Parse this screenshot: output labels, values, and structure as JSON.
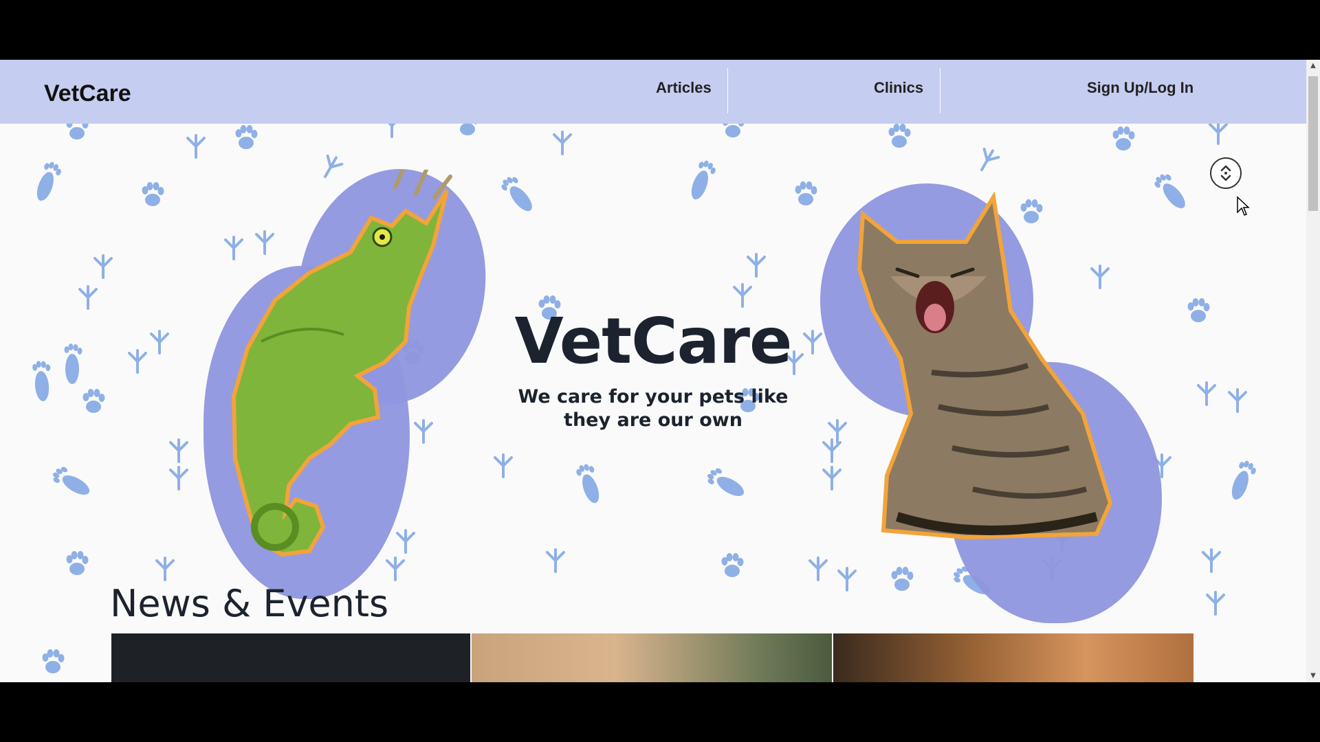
{
  "navbar": {
    "brand": "VetCare",
    "links": [
      "Articles",
      "Clinics",
      "Sign Up/Log In"
    ]
  },
  "hero": {
    "title": "VetCare",
    "subtitle": "We care for your pets like they are our own",
    "images": [
      "chameleon-image",
      "cat-image"
    ]
  },
  "news": {
    "title": "News & Events",
    "cards": [
      "news-card-1",
      "news-card-2",
      "news-card-3"
    ]
  },
  "icons": {
    "scroll": "chevron-up-down-icon",
    "cursor": "mouse-pointer-icon",
    "pattern": "paw-print-icon"
  },
  "colors": {
    "navbar": "#c5cdf0",
    "accent_blob": "#8f96de",
    "paw": "#8fb0e6",
    "outline": "#f2a43a"
  }
}
